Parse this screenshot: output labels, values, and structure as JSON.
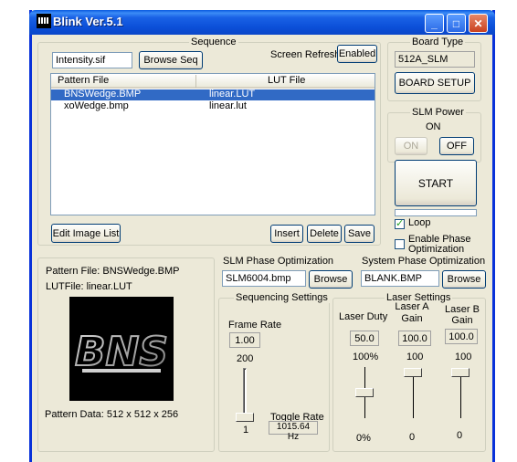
{
  "window": {
    "title": "Blink Ver.5.1"
  },
  "title_buttons": {
    "minimize": "_",
    "maximize": "□",
    "close": "✕"
  },
  "sequence": {
    "group_label": "Sequence",
    "file_value": "Intensity.sif",
    "browse_label": "Browse Seq",
    "screen_refresh_label": "Screen Refresh",
    "screen_refresh_button": "Enabled",
    "columns": [
      "Pattern File",
      "LUT File"
    ],
    "rows": [
      {
        "pattern": "BNSWedge.BMP",
        "lut": "linear.LUT"
      },
      {
        "pattern": "xoWedge.bmp",
        "lut": "linear.lut"
      }
    ],
    "edit_label": "Edit Image List",
    "insert_label": "Insert",
    "delete_label": "Delete",
    "save_label": "Save"
  },
  "board": {
    "group_label": "Board Type",
    "value": "512A_SLM",
    "setup_label": "BOARD SETUP"
  },
  "slm_power": {
    "group_label": "SLM Power",
    "state": "ON",
    "on_label": "ON",
    "off_label": "OFF"
  },
  "start_label": "START",
  "loop": {
    "label": "Loop",
    "checked": true
  },
  "enable_phase": {
    "label_line1": "Enable Phase",
    "label_line2": "Optimization",
    "checked": false
  },
  "pattern_info": {
    "pattern_file": "Pattern File:  BNSWedge.BMP",
    "lut_file": "LUTFile:  linear.LUT",
    "logo_text": "BNS",
    "pattern_data": "Pattern Data:  512 x 512 x 256"
  },
  "slm_phase": {
    "label": "SLM Phase Optimization",
    "value": "SLM6004.bmp",
    "browse_label": "Browse"
  },
  "system_phase": {
    "label": "System Phase Optimization",
    "value": "BLANK.BMP",
    "browse_label": "Browse"
  },
  "sequencing": {
    "group_label": "Sequencing Settings",
    "frame_rate_label": "Frame Rate",
    "frame_rate_value": "1.00",
    "max_label": "200",
    "min_label": "1",
    "toggle_rate_label": "Toggle Rate",
    "toggle_rate_value": "1015.64 Hz",
    "slider_fraction": 0.0
  },
  "laser": {
    "group_label": "Laser Settings",
    "duty_label": "Laser Duty",
    "gain_a_label_line1": "Laser A",
    "gain_a_label_line2": "Gain",
    "gain_b_label_line1": "Laser B",
    "gain_b_label_line2": "Gain",
    "duty_value": "50.0",
    "gain_a_value": "100.0",
    "gain_b_value": "100.0",
    "duty_max": "100%",
    "gain_a_max": "100",
    "gain_b_max": "100",
    "duty_min": "0%",
    "gain_a_min": "0",
    "gain_b_min": "0"
  }
}
